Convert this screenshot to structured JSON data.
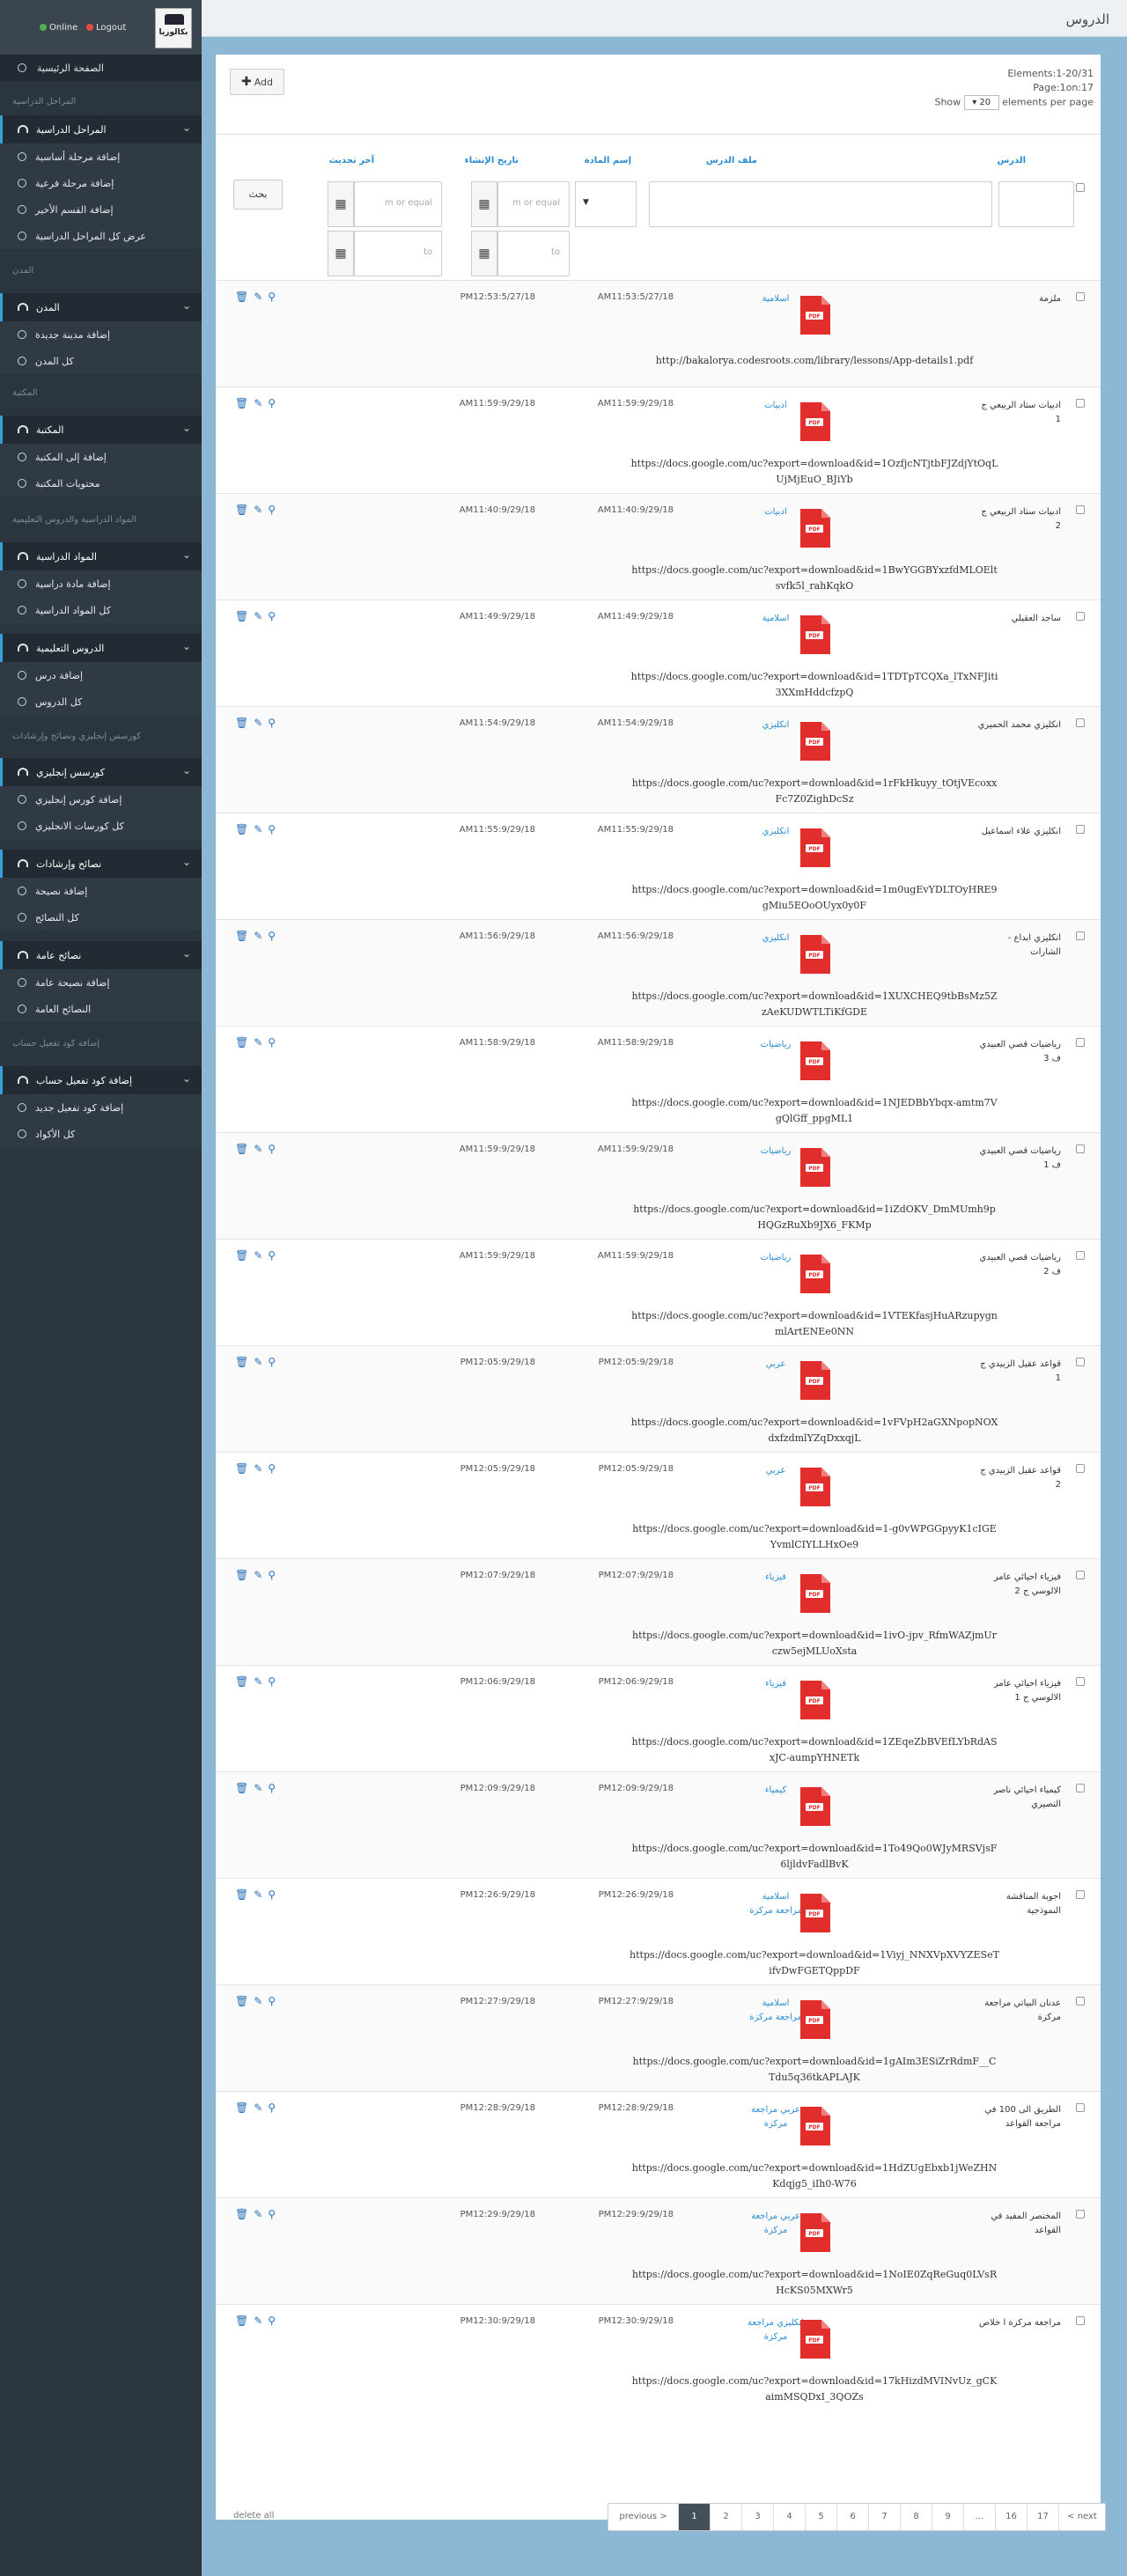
{
  "sidebar": {
    "logo": "بكالوريا",
    "status": {
      "online": "Online",
      "logout": "Logout"
    },
    "home": "الصفحة الرئيسية",
    "sections": {
      "stages": "المراحل الدراسية",
      "cities": "المدن",
      "library": "المكتبة",
      "subjects_lessons": "المواد الدراسية والدروس التعليمية",
      "english_courses": "كورسس إنجليزي ونصائح وإرشادات",
      "activation_code": "إضافة كود تفعيل حساب"
    },
    "groups": [
      {
        "label": "المراحل الدراسية",
        "items": [
          "إضافة مرحلة أساسية",
          "إضافة مرحلة فرعية",
          "إضافة القسم الأخير",
          "عرض كل المراحل الدراسية"
        ]
      },
      {
        "label": "المدن",
        "items": [
          "إضافة مدينة جديدة",
          "كل المدن"
        ]
      },
      {
        "label": "المكتبة",
        "items": [
          "إضافة إلى المكتبة",
          "محتويات المكتبة"
        ]
      },
      {
        "label": "المواد الدراسية",
        "items": [
          "إضافة مادة دراسية",
          "كل المواد الدراسية"
        ]
      },
      {
        "label": "الدروس التعليمية",
        "items": [
          "إضافة درس",
          "كل الدروس"
        ]
      },
      {
        "label": "كورسس إنجليزي",
        "items": [
          "إضافة كورس إنجليزي",
          "كل كورسات الانجليزي"
        ]
      },
      {
        "label": "نصائح وإرشادات",
        "items": [
          "إضافة نصيحة",
          "كل النصائح"
        ]
      },
      {
        "label": "نصائح عامة",
        "items": [
          "إضافة نصيحة عامة",
          "النصائح العامة"
        ]
      },
      {
        "label": "إضافة كود تفعيل حساب",
        "items": [
          "إضافة كود تفعيل جديد",
          "كل الأكواد"
        ]
      }
    ]
  },
  "page": {
    "title": "الدروس",
    "add_label": "Add",
    "info": {
      "elements": "Elements:1-20/31",
      "page": "Page:1on:17",
      "show": "Show",
      "per_page_value": "20",
      "per_page_suffix": "elements per page"
    },
    "columns": {
      "lesson": "الدرس",
      "file": "ملف الدرس",
      "subject": "إسم المادة",
      "created": "تاريخ الإنشاء",
      "updated": "آخر تحديث"
    },
    "filters": {
      "date_placeholder": "m or equal",
      "to_placeholder": "to",
      "search": "بحث",
      "grid_icon": "▦"
    },
    "delete_all": "delete all"
  },
  "rows": [
    {
      "name": "ملزمة",
      "subject": "اسلامية",
      "created": "AM11:53:5/27/18",
      "updated": "PM12:53:5/27/18",
      "url": "http://bakalorya.codesroots.com/library/lessons/App-details1.pdf"
    },
    {
      "name": "ادبيات ستاد الربيعي ج 1",
      "subject": "ادبيات",
      "created": "AM11:59:9/29/18",
      "updated": "AM11:59:9/29/18",
      "url": "https://docs.google.com/uc?export=download&id=1OzfjcNTjtbFJZdjYtOqLUjMjEuO_BJiYb"
    },
    {
      "name": "ادبيات ستاد الربيعي ج 2",
      "subject": "ادبيات",
      "created": "AM11:40:9/29/18",
      "updated": "AM11:40:9/29/18",
      "url": "https://docs.google.com/uc?export=download&id=1BwYGGBYxzfdMLOEltsvfk5l_rahKqkO"
    },
    {
      "name": "ساجد العقيلي",
      "subject": "اسلامية",
      "created": "AM11:49:9/29/18",
      "updated": "AM11:49:9/29/18",
      "url": "https://docs.google.com/uc?export=download&id=1TDTpTCQXa_lTxNFJiti3XXmHddcfzpQ"
    },
    {
      "name": "انكليزي محمد الحميري",
      "subject": "انكليزي",
      "created": "AM11:54:9/29/18",
      "updated": "AM11:54:9/29/18",
      "url": "https://docs.google.com/uc?export=download&id=1rFkHkuyy_tOtjVEcoxxFc7Z0ZighDcSz"
    },
    {
      "name": "انكليزي علاء اسماعيل",
      "subject": "انكليزي",
      "created": "AM11:55:9/29/18",
      "updated": "AM11:55:9/29/18",
      "url": "https://docs.google.com/uc?export=download&id=1m0ugEvYDLTOyHRE9gMiu5EOoOUyx0y0F"
    },
    {
      "name": "انكليزي ابداع - الشارات",
      "subject": "انكليزي",
      "created": "AM11:56:9/29/18",
      "updated": "AM11:56:9/29/18",
      "url": "https://docs.google.com/uc?export=download&id=1XUXCHEQ9tbBsMz5ZzAeKUDWTLTiKfGDE"
    },
    {
      "name": "رياضيات قصي العبيدي ف 3",
      "subject": "رياضيات",
      "created": "AM11:58:9/29/18",
      "updated": "AM11:58:9/29/18",
      "url": "https://docs.google.com/uc?export=download&id=1NJEDBbYbqx-amtm7VgQlGff_ppgML1"
    },
    {
      "name": "رياضيات قصي العبيدي ف 1",
      "subject": "رياضيات",
      "created": "AM11:59:9/29/18",
      "updated": "AM11:59:9/29/18",
      "url": "https://docs.google.com/uc?export=download&id=1iZdOKV_DmMUmh9pHQGzRuXb9JX6_FKMp"
    },
    {
      "name": "رياضيات قصي العبيدي ف 2",
      "subject": "رياضيات",
      "created": "AM11:59:9/29/18",
      "updated": "AM11:59:9/29/18",
      "url": "https://docs.google.com/uc?export=download&id=1VTEKfasjHuARzupygnmlArtENEe0NN"
    },
    {
      "name": "قواعد عقيل الزبيدي ج 1",
      "subject": "عربي",
      "created": "PM12:05:9/29/18",
      "updated": "PM12:05:9/29/18",
      "url": "https://docs.google.com/uc?export=download&id=1vFVpH2aGXNpopNOXdxfzdmlYZqDxxqjL"
    },
    {
      "name": "قواعد عقيل الزبيدي ج 2",
      "subject": "عربي",
      "created": "PM12:05:9/29/18",
      "updated": "PM12:05:9/29/18",
      "url": "https://docs.google.com/uc?export=download&id=1-g0vWPGGpyyK1cIGEYvmlCIYLLHxOe9"
    },
    {
      "name": "فيزياء احيائي عامر الالوسي ج 2",
      "subject": "فيزياء",
      "created": "PM12:07:9/29/18",
      "updated": "PM12:07:9/29/18",
      "url": "https://docs.google.com/uc?export=download&id=1ivO-jpv_RfmWAZjmUrczw5ejMLUoXsta"
    },
    {
      "name": "فيزياء احيائي عامر الالوسي ج 1",
      "subject": "فيزياء",
      "created": "PM12:06:9/29/18",
      "updated": "PM12:06:9/29/18",
      "url": "https://docs.google.com/uc?export=download&id=1ZEqeZbBVEfLYbRdASxJC-aumpYHNETk"
    },
    {
      "name": "كيمياء احيائي ناصر التصيري",
      "subject": "كيمياء",
      "created": "PM12:09:9/29/18",
      "updated": "PM12:09:9/29/18",
      "url": "https://docs.google.com/uc?export=download&id=1To49Qo0WJyMRSVjsF6ljldvFadlBvK"
    },
    {
      "name": "اجوبة المناقشة النموذجية",
      "subject": "اسلامية مراجعة مركزة",
      "created": "PM12:26:9/29/18",
      "updated": "PM12:26:9/29/18",
      "url": "https://docs.google.com/uc?export=download&id=1Viyj_NNXVpXVYZESeTifvDwFGETQppDF"
    },
    {
      "name": "عدنان البياتي مراجعة مركزة",
      "subject": "اسلامية مراجعة مركزة",
      "created": "PM12:27:9/29/18",
      "updated": "PM12:27:9/29/18",
      "url": "https://docs.google.com/uc?export=download&id=1gAIm3ESiZrRdmF__CTdu5q36tkAPLAJK"
    },
    {
      "name": "الطريق الى 100 في مراجعة القواعد",
      "subject": "عربي مراجعة مركزة",
      "created": "PM12:28:9/29/18",
      "updated": "PM12:28:9/29/18",
      "url": "https://docs.google.com/uc?export=download&id=1HdZUgEbxb1jWeZHNKdqjg5_iIh0-W76"
    },
    {
      "name": "المختصر المفيد في القواعد",
      "subject": "عربي مراجعة مركزة",
      "created": "PM12:29:9/29/18",
      "updated": "PM12:29:9/29/18",
      "url": "https://docs.google.com/uc?export=download&id=1NoIE0ZqReGuq0LVsRHcKS05MXWr5"
    },
    {
      "name": "مراجعة مركزة ا خلاص",
      "subject": "انكليزي مراجعة مركزة",
      "created": "PM12:30:9/29/18",
      "updated": "PM12:30:9/29/18",
      "url": "https://docs.google.com/uc?export=download&id=17kHizdMVINvUz_gCKaimMSQDxI_3QOZs"
    }
  ],
  "pager": [
    "previous >",
    "1",
    "2",
    "3",
    "4",
    "5",
    "6",
    "7",
    "8",
    "9",
    "…",
    "16",
    "17",
    "< next"
  ],
  "pager_current": "1"
}
